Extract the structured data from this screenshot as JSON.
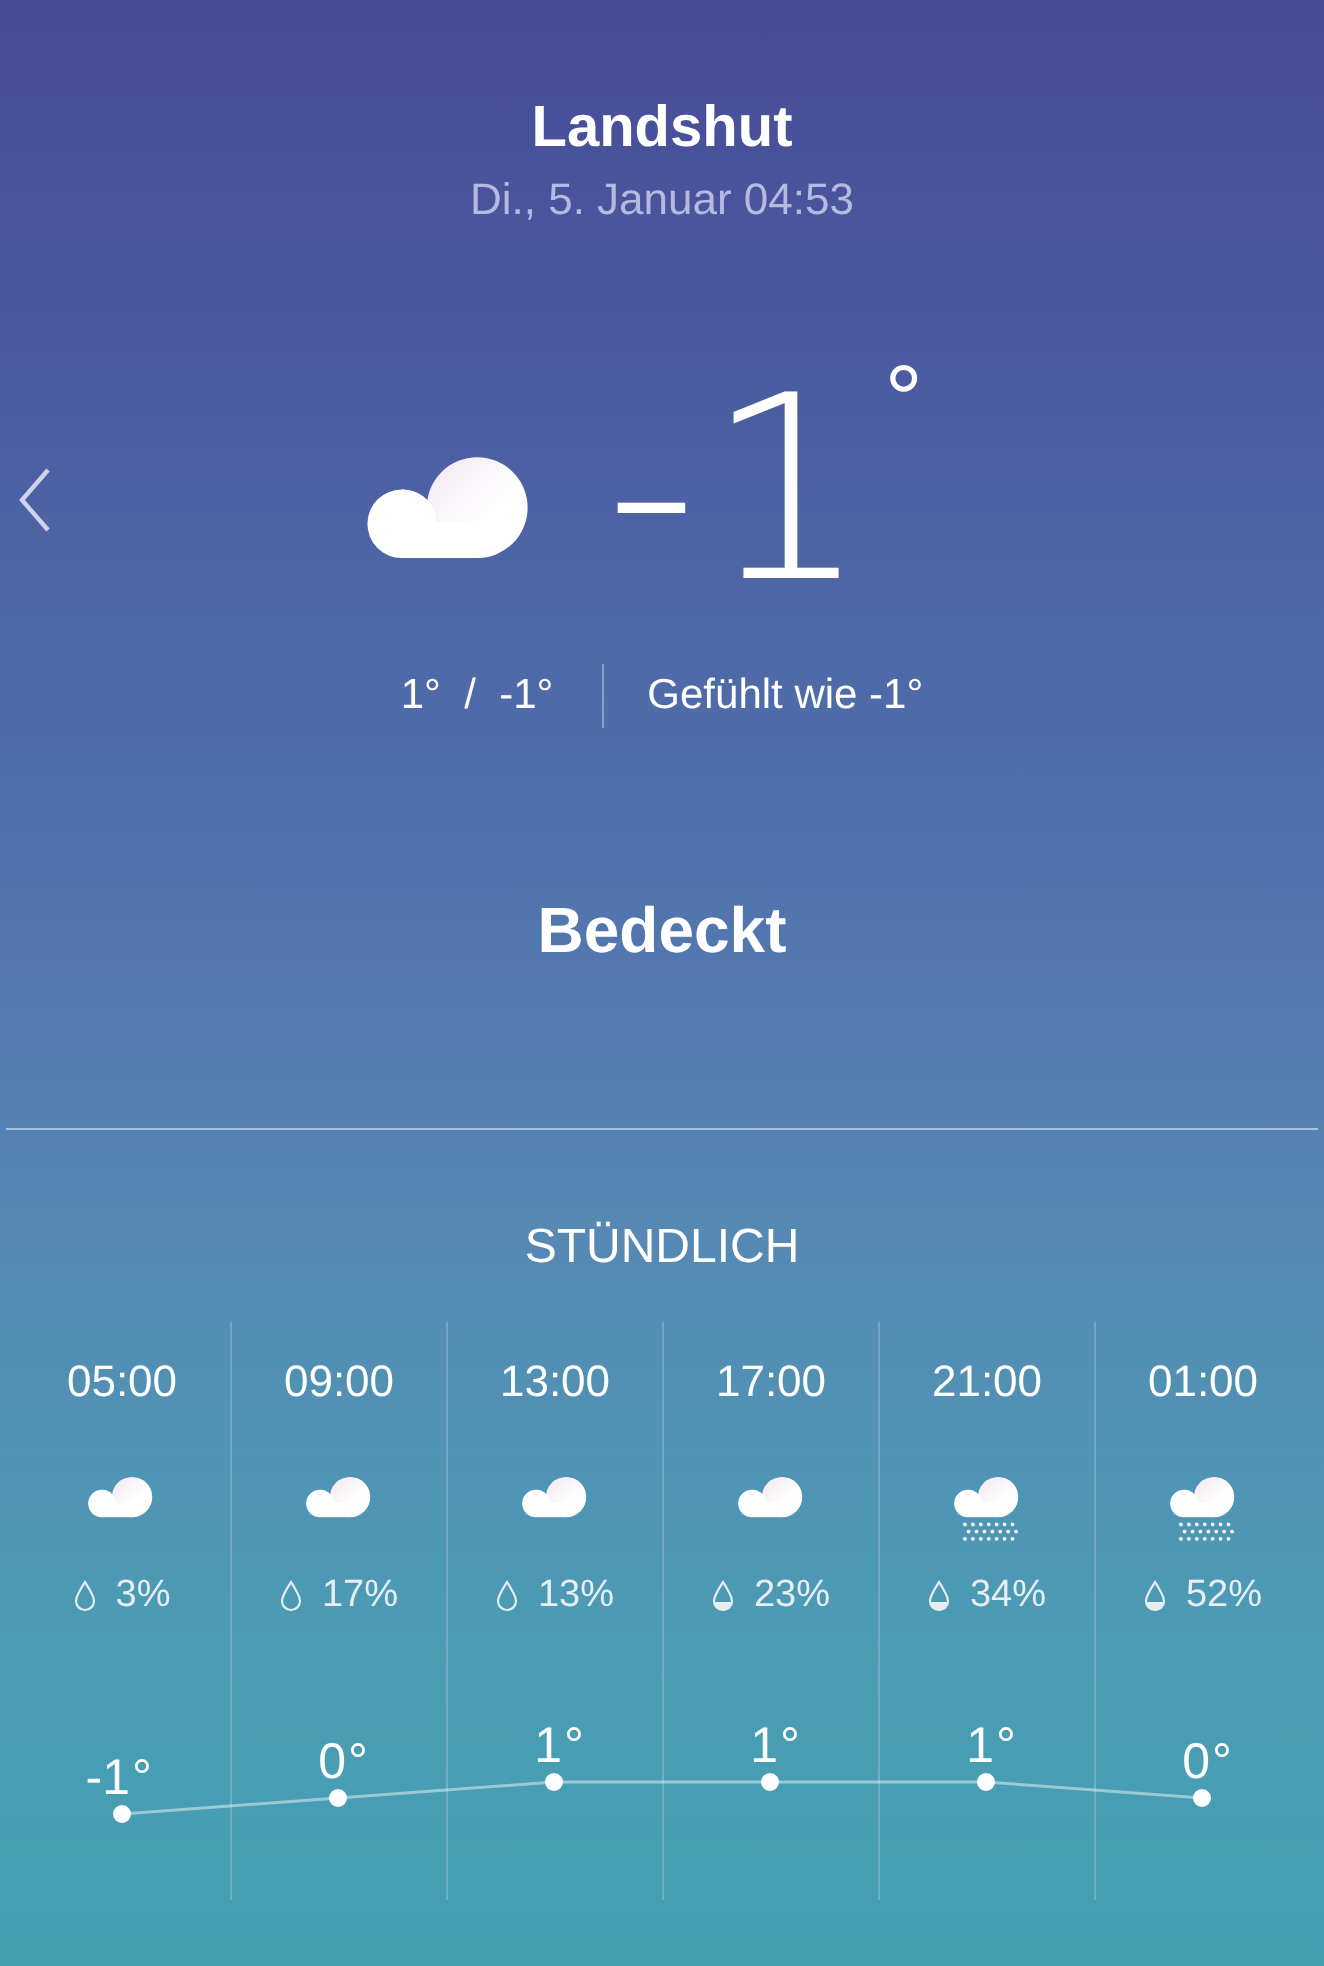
{
  "location": "Landshut",
  "datetime": "Di., 5. Januar 04:53",
  "current": {
    "kind": "cloud",
    "temperature": "-1",
    "unit": "°",
    "high_low": "1°  /  -1°",
    "feels_like": "Gefühlt wie -1°",
    "condition": "Bedeckt"
  },
  "hourly": {
    "title": "STÜNDLICH",
    "hours": [
      {
        "time": "05:00",
        "kind": "cloud",
        "drop_filled": false,
        "precipitation": "3%"
      },
      {
        "time": "09:00",
        "kind": "cloud",
        "drop_filled": false,
        "precipitation": "17%"
      },
      {
        "time": "13:00",
        "kind": "cloud",
        "drop_filled": false,
        "precipitation": "13%"
      },
      {
        "time": "17:00",
        "kind": "cloud",
        "drop_filled": true,
        "precipitation": "23%"
      },
      {
        "time": "21:00",
        "kind": "snow",
        "drop_filled": true,
        "precipitation": "34%"
      },
      {
        "time": "01:00",
        "kind": "snow",
        "drop_filled": true,
        "precipitation": "52%"
      }
    ],
    "temp_unit": "°",
    "chart_data": {
      "type": "line",
      "data_labels": true,
      "series": [
        {
          "color": "#ffffff",
          "marker": "circle",
          "values": [
            -1,
            0,
            1,
            1,
            1,
            0
          ]
        }
      ]
    }
  }
}
